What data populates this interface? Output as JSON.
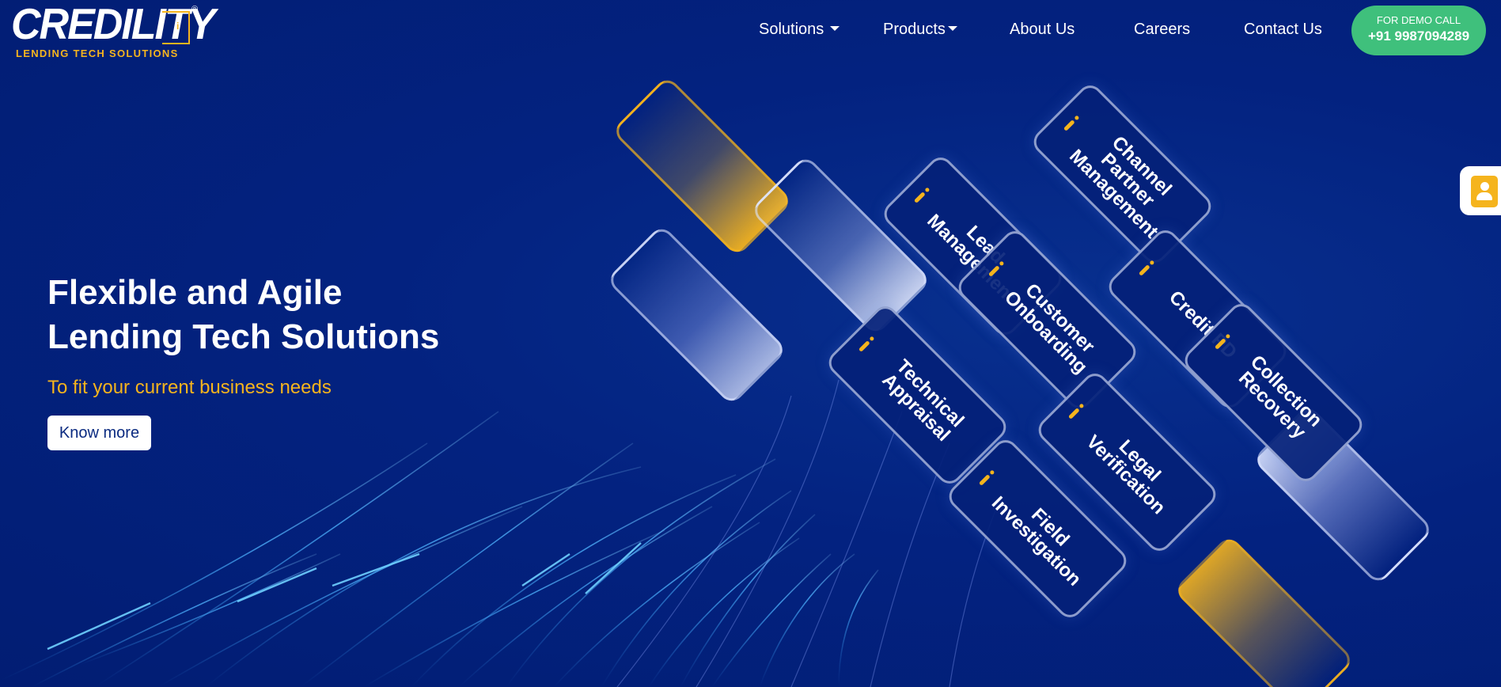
{
  "brand": {
    "logo_word": "CREDILITY",
    "logo_i": "i",
    "logo_reg": "®",
    "tagline": "LENDING TECH SOLUTIONS",
    "accent_color": "#f5b41d",
    "background_color": "#03217d"
  },
  "nav": {
    "items": [
      {
        "label": "Solutions",
        "has_dropdown": true
      },
      {
        "label": "Products",
        "has_dropdown": true
      },
      {
        "label": "About Us",
        "has_dropdown": false
      },
      {
        "label": "Careers",
        "has_dropdown": false
      },
      {
        "label": "Contact Us",
        "has_dropdown": false
      }
    ],
    "demo": {
      "small": "FOR DEMO CALL",
      "phone": "+91 9987094289",
      "color": "#3fc07c"
    }
  },
  "hero": {
    "title_line1": "Flexible and Agile",
    "title_line2": "Lending Tech Solutions",
    "subtitle": "To fit your current business needs",
    "cta": "Know more"
  },
  "tiles": [
    "Channel Partner Management",
    "Lead Management",
    "Customer Onboarding",
    "Credit PD",
    "Technical Appraisal",
    "Collection Recovery",
    "Legal Verification",
    "Field Investigation"
  ],
  "contact_tab": {
    "icon": "contact-book-icon"
  }
}
